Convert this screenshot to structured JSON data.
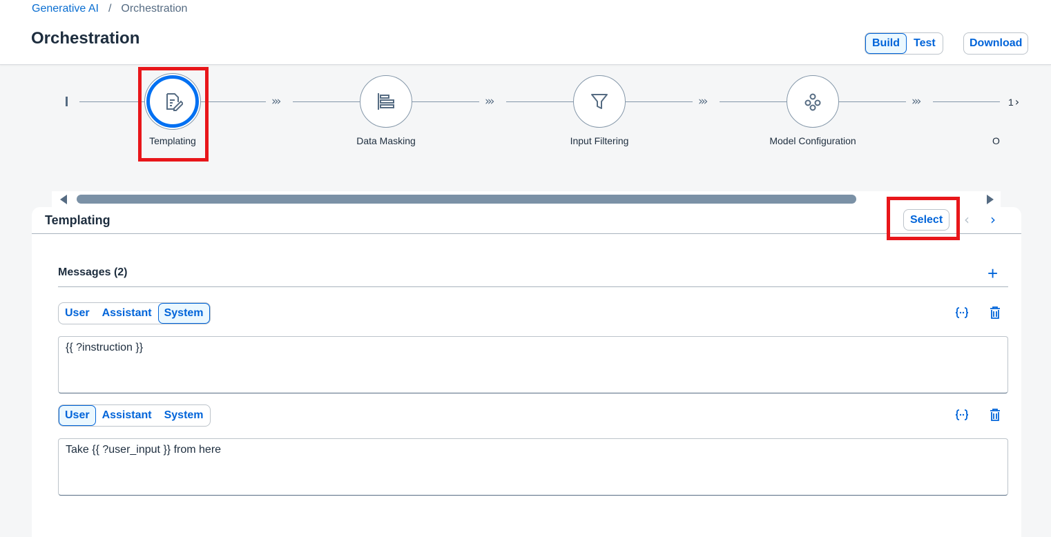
{
  "breadcrumb": {
    "parent": "Generative AI",
    "separator": "/",
    "current": "Orchestration"
  },
  "page": {
    "title": "Orchestration"
  },
  "header": {
    "build_label": "Build",
    "test_label": "Test",
    "download_label": "Download",
    "active_tab": "Build"
  },
  "flow": {
    "steps": [
      {
        "label": "Templating",
        "icon": "edit-document-icon",
        "active": true
      },
      {
        "label": "Data Masking",
        "icon": "align-left-bars-icon",
        "active": false
      },
      {
        "label": "Input Filtering",
        "icon": "filter-icon",
        "active": false
      },
      {
        "label": "Model Configuration",
        "icon": "hub-nodes-icon",
        "active": false
      },
      {
        "label": "O",
        "icon": "",
        "active": false
      }
    ],
    "overflow_count": "1"
  },
  "panel": {
    "title": "Templating",
    "select_label": "Select",
    "messages_header": "Messages (2)",
    "role_labels": {
      "user": "User",
      "assistant": "Assistant",
      "system": "System"
    },
    "messages": [
      {
        "role": "System",
        "content": "{{ ?instruction }}"
      },
      {
        "role": "User",
        "content": "Take {{ ?user_input }} from here"
      }
    ]
  },
  "colors": {
    "accent": "#0064d9",
    "highlight": "#e8161a",
    "active_ring": "#0070f2"
  }
}
